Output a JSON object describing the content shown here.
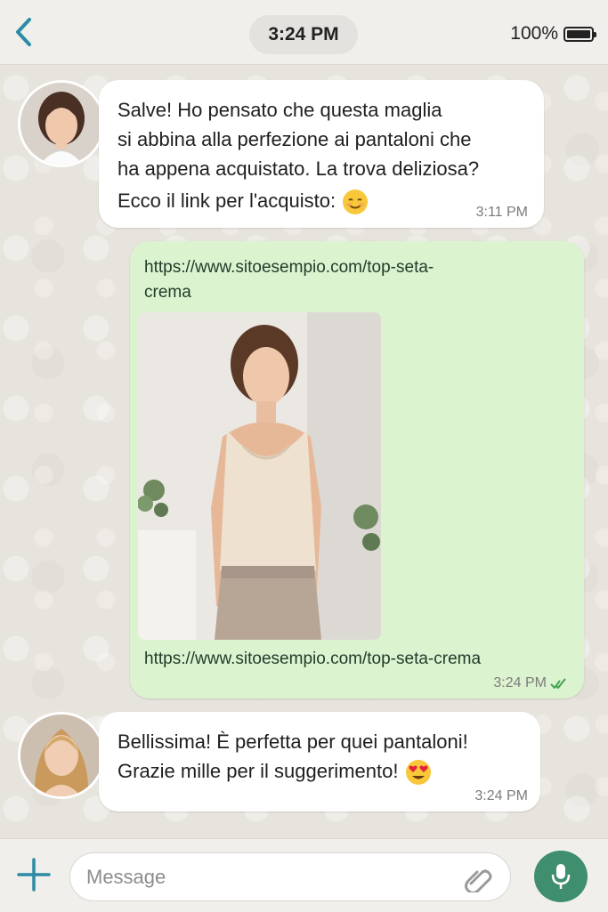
{
  "status": {
    "time": "3:24 PM",
    "battery_label": "100%",
    "battery_level": 1.0
  },
  "icons": {
    "back": "chevron-left-icon",
    "battery": "battery-icon",
    "emoji1": "smiling-face-icon",
    "emoji2": "heart-eyes-icon",
    "checks": "double-check-icon",
    "plus": "plus-icon",
    "attach": "paperclip-icon",
    "mic": "microphone-icon"
  },
  "colors": {
    "accent": "#3f8e6e",
    "back": "#2b8ca3",
    "outgoing_bubble": "#dcf3cf",
    "incoming_bubble": "#ffffff"
  },
  "messages": [
    {
      "direction": "incoming",
      "lines": [
        "Salve! Ho pensato che questa maglia",
        "si abbina alla perfezione ai pantaloni che",
        "ha appena acquistato. La trova deliziosa?",
        "Ecco il link per l'acquisto:"
      ],
      "time": "3:11 PM"
    },
    {
      "direction": "outgoing",
      "link_top": [
        "https://www.sitoesempio.com/top-seta-",
        "crema"
      ],
      "link_bottom": "https://www.sitoesempio.com/top-seta-crema",
      "time": "3:24 PM"
    },
    {
      "direction": "incoming",
      "lines": [
        "Bellissima! È perfetta per quei pantaloni!",
        "Grazie mille per il suggerimento!"
      ],
      "time": "3:24 PM"
    }
  ],
  "composer": {
    "placeholder": "Message"
  }
}
